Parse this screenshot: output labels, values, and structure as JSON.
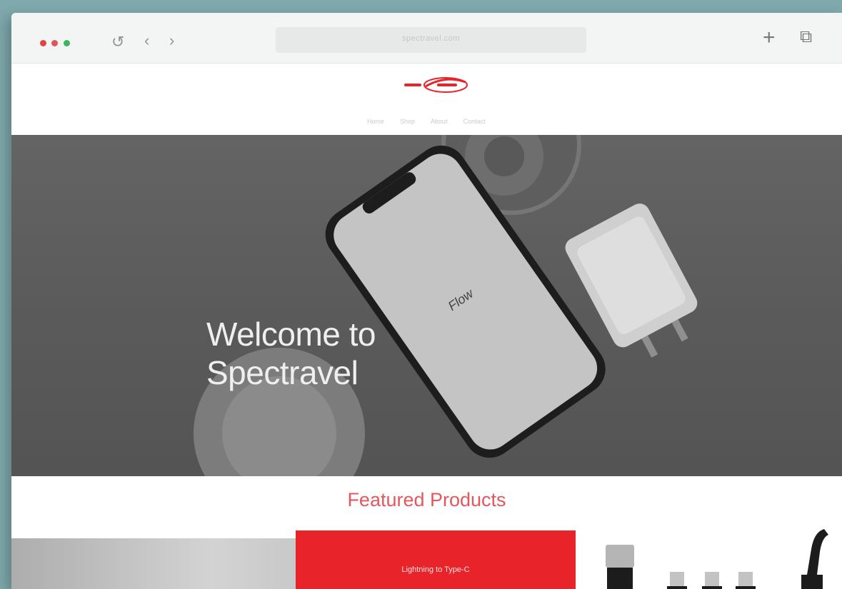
{
  "browser": {
    "url": "spectravel.com"
  },
  "site": {
    "nav": [
      "Home",
      "Shop",
      "About",
      "Contact"
    ]
  },
  "hero": {
    "title_line1": "Welcome to",
    "title_line2": "Spectravel",
    "subtitle": ""
  },
  "featured": {
    "title": "Featured Products",
    "product_label": "Lightning to Type-C"
  },
  "colors": {
    "accent": "#e8232a",
    "featured_title": "#e4575d",
    "hero_bg": "#5e5e5e"
  }
}
